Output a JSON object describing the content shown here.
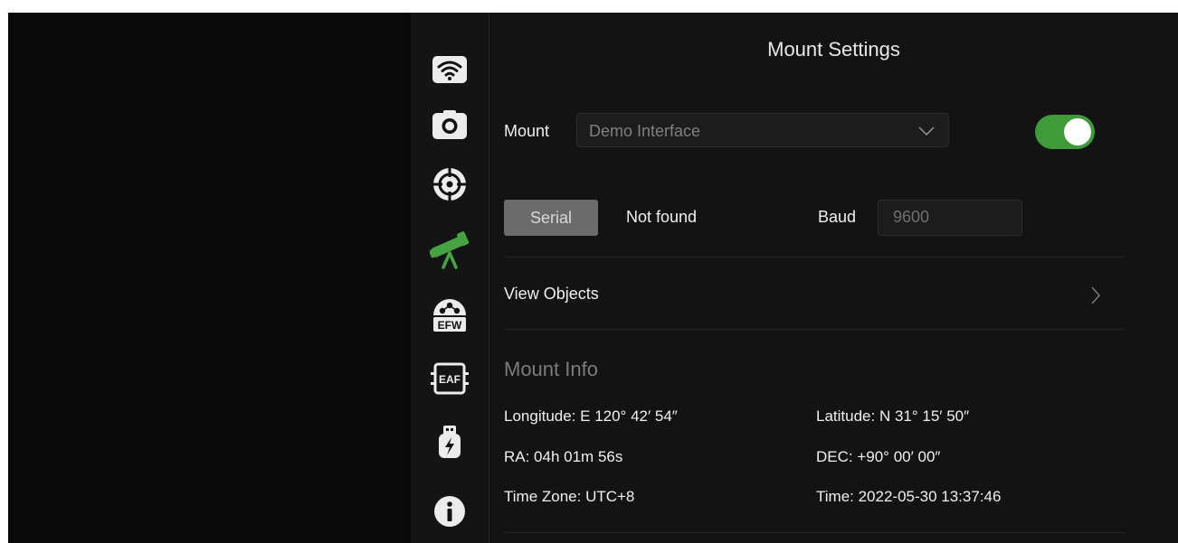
{
  "sidebar": {
    "items": [
      {
        "icon": "wifi-icon",
        "active": false
      },
      {
        "icon": "camera-icon",
        "active": false
      },
      {
        "icon": "guide-crosshair-icon",
        "active": false
      },
      {
        "icon": "telescope-icon",
        "active": true
      },
      {
        "icon": "filter-wheel-icon",
        "label": "EFW",
        "active": false
      },
      {
        "icon": "focuser-icon",
        "label": "EAF",
        "active": false
      },
      {
        "icon": "usb-power-icon",
        "active": false
      },
      {
        "icon": "info-icon",
        "active": false
      }
    ]
  },
  "header": {
    "title": "Mount Settings"
  },
  "mount": {
    "label": "Mount",
    "selected": "Demo Interface",
    "enabled": true
  },
  "connection": {
    "type_button": "Serial",
    "status": "Not found",
    "baud_label": "Baud",
    "baud_value": "9600"
  },
  "view_objects": {
    "label": "View Objects"
  },
  "info": {
    "heading": "Mount Info",
    "longitude": "Longitude: E 120° 42′ 54″",
    "latitude": "Latitude: N 31° 15′ 50″",
    "ra": "RA: 04h 01m 56s",
    "dec": "DEC: +90° 00′ 00″",
    "timezone": "Time Zone: UTC+8",
    "time": "Time: 2022-05-30 13:37:46"
  },
  "colors": {
    "accent": "#3f9a3a",
    "background": "#131313",
    "text": "#f0f0f0",
    "muted": "#7c7c7c"
  }
}
